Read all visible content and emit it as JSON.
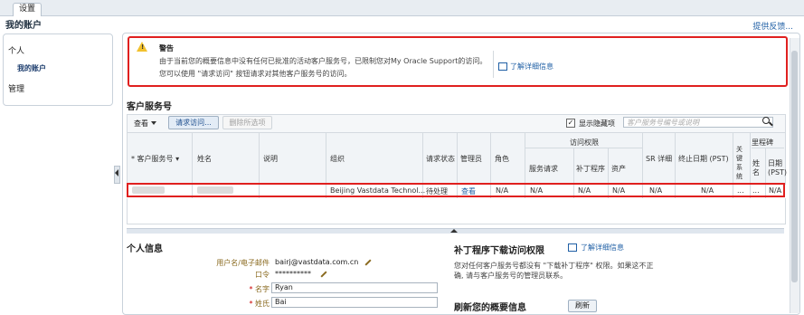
{
  "tabs": [
    "设置"
  ],
  "page_title": "我的账户",
  "help_link": "提供反馈...",
  "sidebar": {
    "personal": "个人",
    "my_account": "我的账户",
    "manage": "管理"
  },
  "warning": {
    "title": "警告",
    "line1": "由于当前您的概要信息中没有任何已批准的活动客户服务号，已限制您对My Oracle Support的访问。",
    "line2": "您可以使用 \"请求访问\" 按钮请求对其他客户服务号的访问。",
    "link": "了解详细信息"
  },
  "csi_section": {
    "title": "客户服务号",
    "toolbar": {
      "view": "查看",
      "request_access": "请求访问...",
      "delete_selected": "删除所选项",
      "show_hidden": "显示隐藏项",
      "search_placeholder": "客户服务号编号或说明"
    },
    "headers": {
      "csi": "* 客户服务号 ▾",
      "name": "姓名",
      "desc": "说明",
      "org": "组织",
      "status": "请求状态",
      "admin": "管理员",
      "role": "角色",
      "access": "访问权限",
      "service_req": "服务请求",
      "patches": "补丁程序",
      "assets": "资产",
      "sr_detail": "SR 详细",
      "end_date": "终止日期 (PST)",
      "key_system": "关键系统",
      "milestone": "里程碑",
      "ms_name": "姓名",
      "ms_date": "日期 (PST)"
    },
    "row": {
      "org": "Beijing Vastdata Technol...",
      "status": "待处理",
      "admin": "查看",
      "role": "N/A",
      "service_req": "N/A",
      "patches": "N/A",
      "assets": "N/A",
      "sr_detail": "N/A",
      "end_date": "N/A",
      "key": "...",
      "ms_name": "...",
      "ms_date": "N/A"
    }
  },
  "personal_info": {
    "title": "个人信息",
    "username_label": "用户名/电子邮件",
    "username": "bairj@vastdata.com.cn",
    "password_label": "口令",
    "password": "**********",
    "first_name_label": "名字",
    "first_name": "Ryan",
    "last_name_label": "姓氏",
    "last_name": "Bai"
  },
  "patch_access": {
    "title": "补丁程序下载访问权限",
    "link": "了解详细信息",
    "text1": "您对任何客户服务号都没有 \"下载补丁程序\" 权限。如果这不正",
    "text2": "确, 请与客户服务号的管理员联系。"
  },
  "refresh": {
    "title": "刷新您的概要信息",
    "button": "刷新"
  }
}
